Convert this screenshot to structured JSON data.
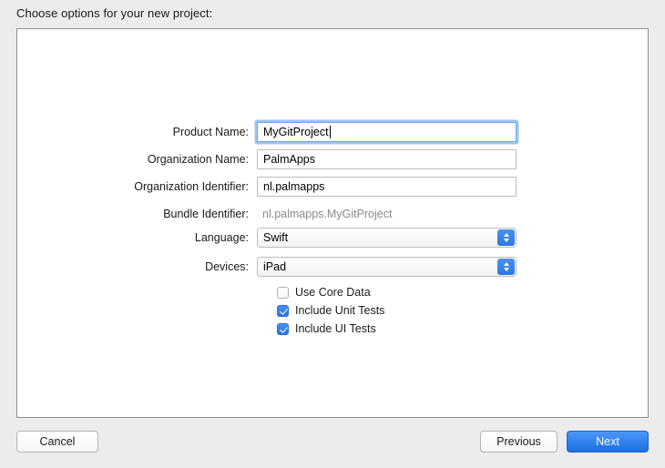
{
  "dialog": {
    "prompt": "Choose options for your new project:"
  },
  "form": {
    "fields": [
      {
        "label": "Product Name:",
        "value": "MyGitProject",
        "type": "text",
        "focused": true
      },
      {
        "label": "Organization Name:",
        "value": "PalmApps",
        "type": "text",
        "focused": false
      },
      {
        "label": "Organization Identifier:",
        "value": "nl.palmapps",
        "type": "text",
        "focused": false
      },
      {
        "label": "Bundle Identifier:",
        "value": "nl.palmapps.MyGitProject",
        "type": "static",
        "focused": false
      },
      {
        "label": "Language:",
        "value": "Swift",
        "type": "popup",
        "focused": false
      },
      {
        "label": "Devices:",
        "value": "iPad",
        "type": "popup",
        "focused": false
      }
    ],
    "checkboxes": [
      {
        "label": "Use Core Data",
        "checked": false
      },
      {
        "label": "Include Unit Tests",
        "checked": true
      },
      {
        "label": "Include UI Tests",
        "checked": true
      }
    ]
  },
  "buttons": {
    "cancel": "Cancel",
    "previous": "Previous",
    "next": "Next"
  },
  "colors": {
    "window_background": "#ececec",
    "panel_background": "#ffffff",
    "panel_border": "#8f8f8f",
    "accent_blue": "#2f77e0",
    "focus_ring": "#6aa5e8",
    "static_text": "#8a8a8a"
  }
}
